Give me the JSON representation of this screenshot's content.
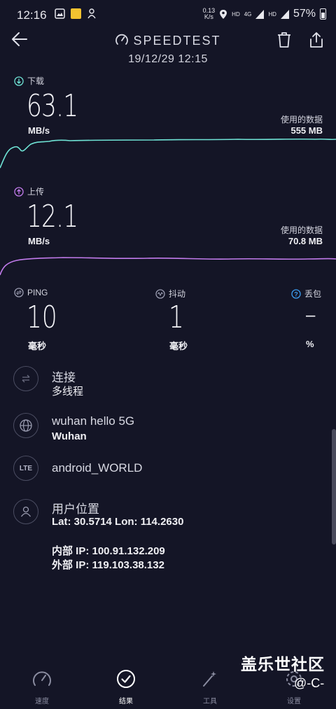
{
  "status_bar": {
    "time": "12:16",
    "net_speed_value": "0.13",
    "net_speed_unit": "K/s",
    "hd1": "HD",
    "hd2": "HD",
    "signal_4g": "4G",
    "battery_percent": "57%"
  },
  "header": {
    "title": "SPEEDTEST",
    "timestamp": "19/12/29 12:15"
  },
  "download": {
    "label": "下载",
    "value": "63.1",
    "unit": "MB/s",
    "data_label": "使用的数据",
    "data_value": "555 MB",
    "color": "#6fe3d5"
  },
  "upload": {
    "label": "上传",
    "value": "12.1",
    "unit": "MB/s",
    "data_label": "使用的数据",
    "data_value": "70.8 MB",
    "color": "#c27bec"
  },
  "metrics": {
    "ping": {
      "label": "PING",
      "value": "10",
      "unit": "毫秒"
    },
    "jitter": {
      "label": "抖动",
      "value": "1",
      "unit": "毫秒"
    },
    "loss": {
      "label": "丢包",
      "value": "–",
      "unit": "%"
    }
  },
  "info": {
    "connection": {
      "title": "连接",
      "sub": "多线程"
    },
    "server": {
      "title": "wuhan hello 5G",
      "sub": "Wuhan"
    },
    "provider": {
      "title": "android_WORLD",
      "icon_text": "LTE"
    },
    "location": {
      "title": "用户位置",
      "sub": "Lat: 30.5714 Lon: 114.2630"
    },
    "ip": {
      "internal": "内部 IP: 100.91.132.209",
      "external": "外部 IP: 119.103.38.132"
    }
  },
  "nav": {
    "speed": "速度",
    "results": "结果",
    "tools": "工具",
    "settings": "设置"
  },
  "watermark": {
    "line1": "盖乐世社区",
    "line2": "@-C-"
  }
}
